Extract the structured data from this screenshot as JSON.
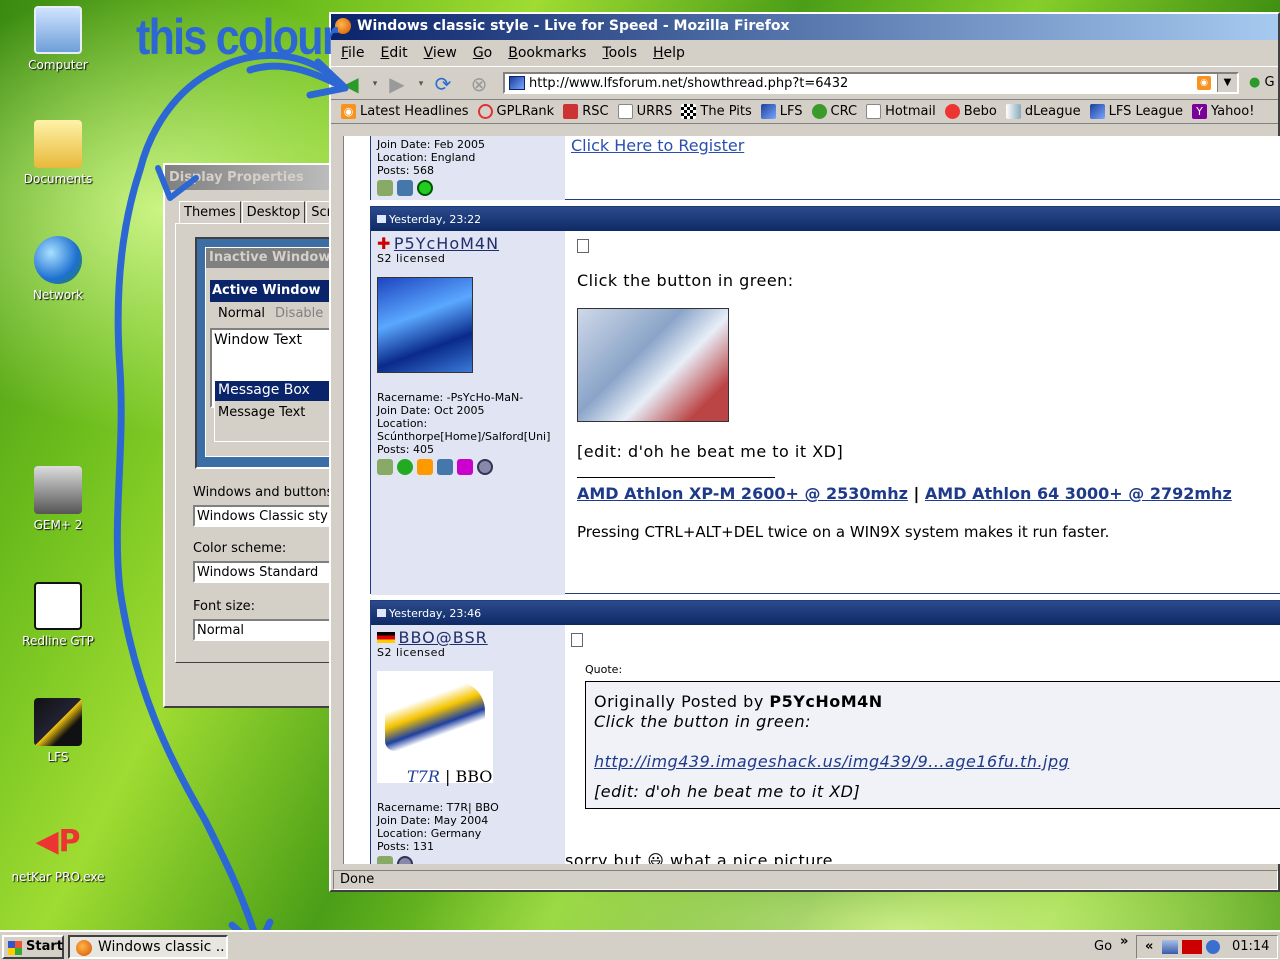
{
  "annotation": {
    "text": "this colour",
    "color": "#2d67d4"
  },
  "desktop_icons": [
    {
      "label": "Computer",
      "icon": "computer-icon"
    },
    {
      "label": "Documents",
      "icon": "documents-folder-icon"
    },
    {
      "label": "Network",
      "icon": "network-globe-icon"
    },
    {
      "label": "GEM+ 2",
      "icon": "gem-portrait-icon"
    },
    {
      "label": "Redline GTP",
      "icon": "redline-logo-icon"
    },
    {
      "label": "LFS",
      "icon": "lfs-logo-icon"
    },
    {
      "label": "netKar PRO.exe",
      "icon": "netkar-logo-icon"
    }
  ],
  "display_properties": {
    "title": "Display Properties",
    "tabs": [
      "Themes",
      "Desktop",
      "Scre"
    ],
    "preview": {
      "inactive": "Inactive Window",
      "active": "Active Window",
      "normal": "Normal",
      "disabled": "Disable",
      "window_text": "Window Text",
      "message_box": "Message Box",
      "message_text": "Message Text"
    },
    "windows_buttons_label": "Windows and buttons:",
    "windows_buttons_value": "Windows Classic style",
    "color_scheme_label": "Color scheme:",
    "color_scheme_value": "Windows Standard",
    "font_size_label": "Font size:",
    "font_size_value": "Normal"
  },
  "firefox": {
    "title": "Windows classic style - Live for Speed - Mozilla Firefox",
    "menu": [
      "File",
      "Edit",
      "View",
      "Go",
      "Bookmarks",
      "Tools",
      "Help"
    ],
    "url": "http://www.lfsforum.net/showthread.php?t=6432",
    "go_label": "G",
    "bookmarks": [
      "Latest Headlines",
      "GPLRank",
      "RSC",
      "URRS",
      "The Pits",
      "LFS",
      "CRC",
      "Hotmail",
      "Bebo",
      "dLeague",
      "LFS League",
      "Yahoo!"
    ],
    "status": "Done"
  },
  "posts": {
    "first": {
      "join": "Join Date: Feb 2005",
      "location": "Location: England",
      "posts": "Posts: 568",
      "register_link": "Click Here to Register"
    },
    "second": {
      "date": "Yesterday, 23:22",
      "user": "P5YcHoM4N",
      "rank": "S2 licensed",
      "racername": "Racername: -PsYcHo-MaN-",
      "join": "Join Date: Oct 2005",
      "location": "Location:",
      "location2": "Scúnthorpe[Home]/Salford[Uni]",
      "posts": "Posts: 405",
      "line1": "Click the button in green:",
      "line2": "[edit: d'oh he beat me to it XD]",
      "sig1": "AMD Athlon XP-M 2600+ @ 2530mhz",
      "sig_sep": "|",
      "sig2": "AMD Athlon 64 3000+ @ 2792mhz",
      "sig3": "Pressing CTRL+ALT+DEL twice on a WIN9X system makes it run faster."
    },
    "third": {
      "date": "Yesterday, 23:46",
      "user": "BBO@BSR",
      "rank": "S2 licensed",
      "avatar_caption_left": "T7R",
      "avatar_caption_right": "BBO",
      "racername": "Racername: T7R| BBO",
      "join": "Join Date: May 2004",
      "location": "Location: Germany",
      "posts": "Posts: 131",
      "quote_label": "Quote:",
      "quote_by_prefix": "Originally Posted by",
      "quote_by": "P5YcHoM4N",
      "quote_line1": "Click the button in green:",
      "quote_link": "http://img439.imageshack.us/img439/9...age16fu.th.jpg",
      "quote_line2": "[edit: d'oh he beat me to it XD]",
      "reply": "sorry but 😃 what a nice picture"
    }
  },
  "taskbar": {
    "start": "Start",
    "task": "Windows classic ...",
    "go": "Go",
    "chevron": "»",
    "tray_chevron": "«",
    "clock": "01:14"
  }
}
